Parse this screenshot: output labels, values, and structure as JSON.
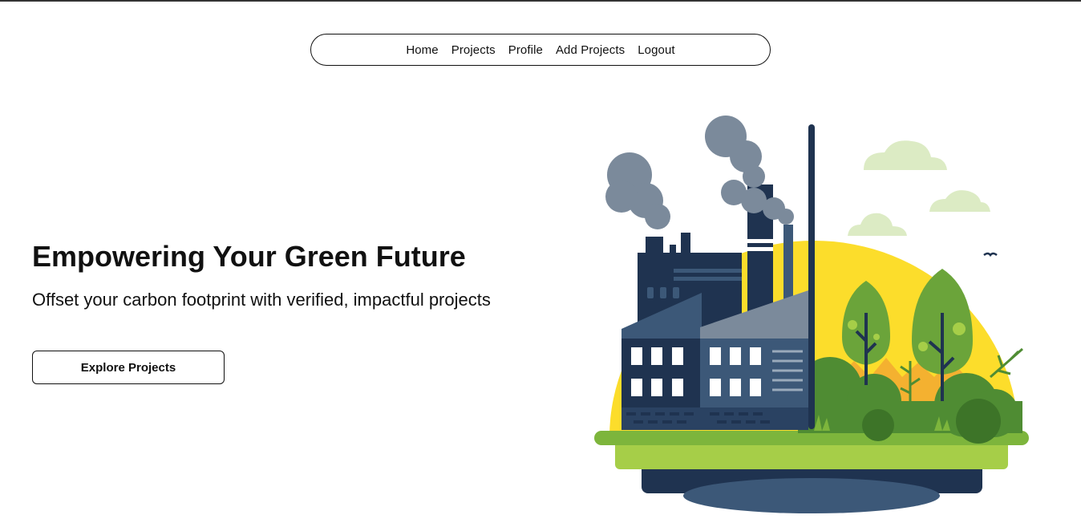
{
  "nav": {
    "items": [
      {
        "label": "Home"
      },
      {
        "label": "Projects"
      },
      {
        "label": "Profile"
      },
      {
        "label": "Add Projects"
      },
      {
        "label": "Logout"
      }
    ]
  },
  "hero": {
    "title": "Empowering Your Green Future",
    "subtitle": "Offset your carbon footprint with verified, impactful projects",
    "cta_label": "Explore Projects"
  },
  "illustration": {
    "icon": "factory-and-trees-illustration"
  },
  "colors": {
    "text": "#111111",
    "sun": "#FCDD2B",
    "grass": "#8CC63F",
    "tree": "#6BA43A",
    "factory_dark": "#1F3350",
    "factory_mid": "#3C5878",
    "smoke": "#7B8A9B",
    "cloud": "#DCEBC4"
  }
}
